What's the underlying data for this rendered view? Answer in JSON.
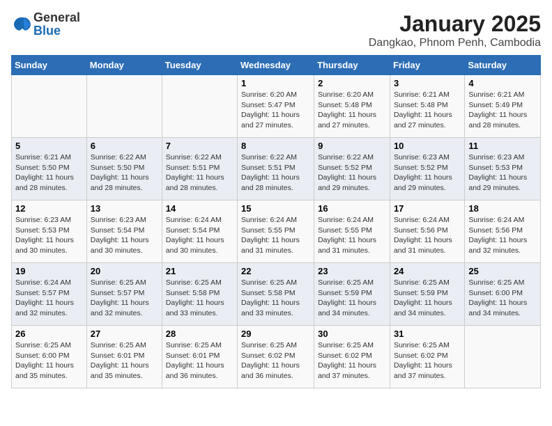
{
  "header": {
    "logo_general": "General",
    "logo_blue": "Blue",
    "title": "January 2025",
    "subtitle": "Dangkao, Phnom Penh, Cambodia"
  },
  "weekdays": [
    "Sunday",
    "Monday",
    "Tuesday",
    "Wednesday",
    "Thursday",
    "Friday",
    "Saturday"
  ],
  "weeks": [
    [
      {
        "day": "",
        "info": ""
      },
      {
        "day": "",
        "info": ""
      },
      {
        "day": "",
        "info": ""
      },
      {
        "day": "1",
        "info": "Sunrise: 6:20 AM\nSunset: 5:47 PM\nDaylight: 11 hours and 27 minutes."
      },
      {
        "day": "2",
        "info": "Sunrise: 6:20 AM\nSunset: 5:48 PM\nDaylight: 11 hours and 27 minutes."
      },
      {
        "day": "3",
        "info": "Sunrise: 6:21 AM\nSunset: 5:48 PM\nDaylight: 11 hours and 27 minutes."
      },
      {
        "day": "4",
        "info": "Sunrise: 6:21 AM\nSunset: 5:49 PM\nDaylight: 11 hours and 28 minutes."
      }
    ],
    [
      {
        "day": "5",
        "info": "Sunrise: 6:21 AM\nSunset: 5:50 PM\nDaylight: 11 hours and 28 minutes."
      },
      {
        "day": "6",
        "info": "Sunrise: 6:22 AM\nSunset: 5:50 PM\nDaylight: 11 hours and 28 minutes."
      },
      {
        "day": "7",
        "info": "Sunrise: 6:22 AM\nSunset: 5:51 PM\nDaylight: 11 hours and 28 minutes."
      },
      {
        "day": "8",
        "info": "Sunrise: 6:22 AM\nSunset: 5:51 PM\nDaylight: 11 hours and 28 minutes."
      },
      {
        "day": "9",
        "info": "Sunrise: 6:22 AM\nSunset: 5:52 PM\nDaylight: 11 hours and 29 minutes."
      },
      {
        "day": "10",
        "info": "Sunrise: 6:23 AM\nSunset: 5:52 PM\nDaylight: 11 hours and 29 minutes."
      },
      {
        "day": "11",
        "info": "Sunrise: 6:23 AM\nSunset: 5:53 PM\nDaylight: 11 hours and 29 minutes."
      }
    ],
    [
      {
        "day": "12",
        "info": "Sunrise: 6:23 AM\nSunset: 5:53 PM\nDaylight: 11 hours and 30 minutes."
      },
      {
        "day": "13",
        "info": "Sunrise: 6:23 AM\nSunset: 5:54 PM\nDaylight: 11 hours and 30 minutes."
      },
      {
        "day": "14",
        "info": "Sunrise: 6:24 AM\nSunset: 5:54 PM\nDaylight: 11 hours and 30 minutes."
      },
      {
        "day": "15",
        "info": "Sunrise: 6:24 AM\nSunset: 5:55 PM\nDaylight: 11 hours and 31 minutes."
      },
      {
        "day": "16",
        "info": "Sunrise: 6:24 AM\nSunset: 5:55 PM\nDaylight: 11 hours and 31 minutes."
      },
      {
        "day": "17",
        "info": "Sunrise: 6:24 AM\nSunset: 5:56 PM\nDaylight: 11 hours and 31 minutes."
      },
      {
        "day": "18",
        "info": "Sunrise: 6:24 AM\nSunset: 5:56 PM\nDaylight: 11 hours and 32 minutes."
      }
    ],
    [
      {
        "day": "19",
        "info": "Sunrise: 6:24 AM\nSunset: 5:57 PM\nDaylight: 11 hours and 32 minutes."
      },
      {
        "day": "20",
        "info": "Sunrise: 6:25 AM\nSunset: 5:57 PM\nDaylight: 11 hours and 32 minutes."
      },
      {
        "day": "21",
        "info": "Sunrise: 6:25 AM\nSunset: 5:58 PM\nDaylight: 11 hours and 33 minutes."
      },
      {
        "day": "22",
        "info": "Sunrise: 6:25 AM\nSunset: 5:58 PM\nDaylight: 11 hours and 33 minutes."
      },
      {
        "day": "23",
        "info": "Sunrise: 6:25 AM\nSunset: 5:59 PM\nDaylight: 11 hours and 34 minutes."
      },
      {
        "day": "24",
        "info": "Sunrise: 6:25 AM\nSunset: 5:59 PM\nDaylight: 11 hours and 34 minutes."
      },
      {
        "day": "25",
        "info": "Sunrise: 6:25 AM\nSunset: 6:00 PM\nDaylight: 11 hours and 34 minutes."
      }
    ],
    [
      {
        "day": "26",
        "info": "Sunrise: 6:25 AM\nSunset: 6:00 PM\nDaylight: 11 hours and 35 minutes."
      },
      {
        "day": "27",
        "info": "Sunrise: 6:25 AM\nSunset: 6:01 PM\nDaylight: 11 hours and 35 minutes."
      },
      {
        "day": "28",
        "info": "Sunrise: 6:25 AM\nSunset: 6:01 PM\nDaylight: 11 hours and 36 minutes."
      },
      {
        "day": "29",
        "info": "Sunrise: 6:25 AM\nSunset: 6:02 PM\nDaylight: 11 hours and 36 minutes."
      },
      {
        "day": "30",
        "info": "Sunrise: 6:25 AM\nSunset: 6:02 PM\nDaylight: 11 hours and 37 minutes."
      },
      {
        "day": "31",
        "info": "Sunrise: 6:25 AM\nSunset: 6:02 PM\nDaylight: 11 hours and 37 minutes."
      },
      {
        "day": "",
        "info": ""
      }
    ]
  ]
}
